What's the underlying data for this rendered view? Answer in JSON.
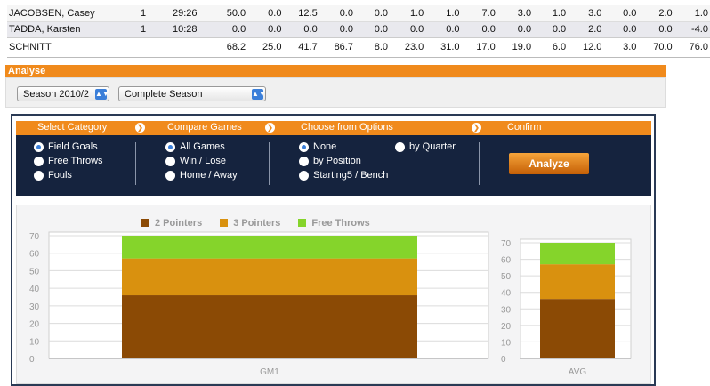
{
  "stats": {
    "rows": [
      {
        "name": "JACOBSEN, Casey",
        "cells": [
          "1",
          "29:26",
          "50.0",
          "0.0",
          "12.5",
          "0.0",
          "0.0",
          "1.0",
          "1.0",
          "7.0",
          "3.0",
          "1.0",
          "3.0",
          "0.0",
          "2.0",
          "1.0"
        ]
      },
      {
        "name": "TADDA, Karsten",
        "cells": [
          "1",
          "10:28",
          "0.0",
          "0.0",
          "0.0",
          "0.0",
          "0.0",
          "0.0",
          "0.0",
          "0.0",
          "0.0",
          "0.0",
          "2.0",
          "0.0",
          "0.0",
          "-4.0"
        ]
      }
    ],
    "total": {
      "name": "SCHNITT",
      "cells": [
        "",
        "",
        "68.2",
        "25.0",
        "41.7",
        "86.7",
        "8.0",
        "23.0",
        "31.0",
        "17.0",
        "19.0",
        "6.0",
        "12.0",
        "3.0",
        "70.0",
        "76.0"
      ]
    }
  },
  "analyse": {
    "title": "Analyse",
    "season_select": "Season 2010/2",
    "period_select": "Complete Season"
  },
  "steps": {
    "select_category": "Select Category",
    "compare_games": "Compare Games",
    "choose_options": "Choose from Options",
    "confirm": "Confirm"
  },
  "options": {
    "category": [
      "Field Goals",
      "Free Throws",
      "Fouls"
    ],
    "category_selected": 0,
    "compare": [
      "All Games",
      "Win / Lose",
      "Home / Away"
    ],
    "compare_selected": 0,
    "choose": [
      "None",
      "by Position",
      "Starting5 / Bench",
      "by Quarter"
    ],
    "choose_selected": 0,
    "analyze_button": "Analyze"
  },
  "colors": {
    "two_pointers": "#8b4a05",
    "three_pointers": "#d9910f",
    "free_throws": "#85d42b",
    "accent": "#f08a1c",
    "navy": "#15233e"
  },
  "chart_data": [
    {
      "type": "bar",
      "stacked": true,
      "categories": [
        "GM1"
      ],
      "series": [
        {
          "name": "2 Pointers",
          "values": [
            36
          ]
        },
        {
          "name": "3 Pointers",
          "values": [
            21
          ]
        },
        {
          "name": "Free Throws",
          "values": [
            13
          ]
        }
      ],
      "yticks": [
        "0",
        "10",
        "20",
        "30",
        "40",
        "50",
        "60",
        "70"
      ],
      "ylim": [
        0,
        70
      ],
      "grid": true,
      "legend": "top"
    },
    {
      "type": "bar",
      "stacked": true,
      "categories": [
        "AVG"
      ],
      "series": [
        {
          "name": "2 Pointers",
          "values": [
            36
          ]
        },
        {
          "name": "3 Pointers",
          "values": [
            21
          ]
        },
        {
          "name": "Free Throws",
          "values": [
            13
          ]
        }
      ],
      "yticks": [
        "0",
        "10",
        "20",
        "30",
        "40",
        "50",
        "60",
        "70"
      ],
      "ylim": [
        0,
        70
      ],
      "grid": true
    }
  ]
}
